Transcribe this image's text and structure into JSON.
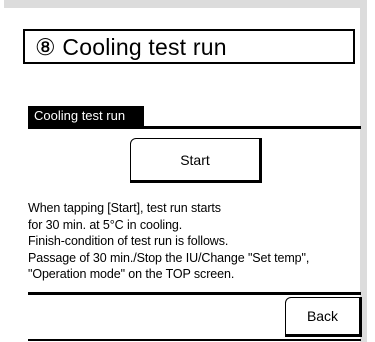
{
  "header": {
    "title": "⑧ Cooling test run"
  },
  "section": {
    "label": "Cooling test run"
  },
  "buttons": {
    "start": "Start",
    "back": "Back"
  },
  "description": [
    "When tapping [Start], test run starts",
    "for 30 min. at 5°C in cooling.",
    "Finish-condition of test run is follows.",
    "Passage of 30 min./Stop the IU/Change \"Set temp\",",
    "\"Operation mode\" on the TOP screen."
  ]
}
